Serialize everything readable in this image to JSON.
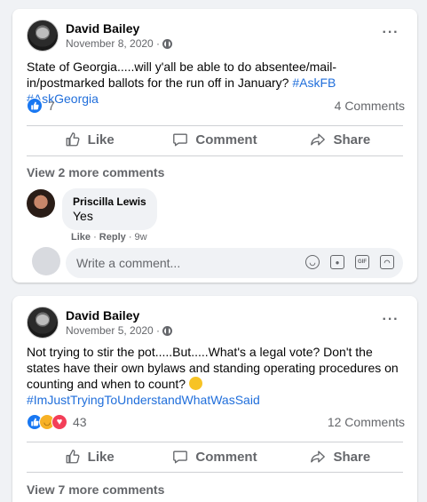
{
  "posts": [
    {
      "author": "David Bailey",
      "date": "November 8, 2020 ·",
      "text": "State of Georgia.....will y'all be able to do absentee/mail-in/postmarked ballots for the run off in January? ",
      "hashtags": [
        "#AskFB",
        "#AskGeorgia"
      ],
      "reactions_count": "7",
      "comments_count": "4 Comments",
      "view_more": "View 2 more comments",
      "comment": {
        "author": "Priscilla Lewis",
        "text": "Yes",
        "like": "Like",
        "reply": "Reply",
        "age": "9w"
      },
      "write_placeholder": "Write a comment..."
    },
    {
      "author": "David Bailey",
      "date": "November 5, 2020 ·",
      "text": "Not trying to stir the pot.....But.....What's a legal vote? Don't the states have their own bylaws and standing operating procedures on counting and when to count? ",
      "hashtags": [
        "#ImJustTryingToUnderstandWhatWasSaid"
      ],
      "reactions_count": "43",
      "comments_count": "12 Comments",
      "view_more": "View 7 more comments"
    }
  ],
  "actions": {
    "like": "Like",
    "comment": "Comment",
    "share": "Share"
  },
  "more_glyph": "···",
  "colors": {
    "link": "#216fdb",
    "like_blue": "#1877f2",
    "love_red": "#f33e58",
    "haha_yellow": "#f7b125",
    "secondary_text": "#65676b"
  },
  "icons": [
    "globe-icon",
    "more-icon",
    "like-icon",
    "comment-icon",
    "share-icon",
    "emoji-icon",
    "camera-icon",
    "gif-icon",
    "sticker-icon"
  ]
}
